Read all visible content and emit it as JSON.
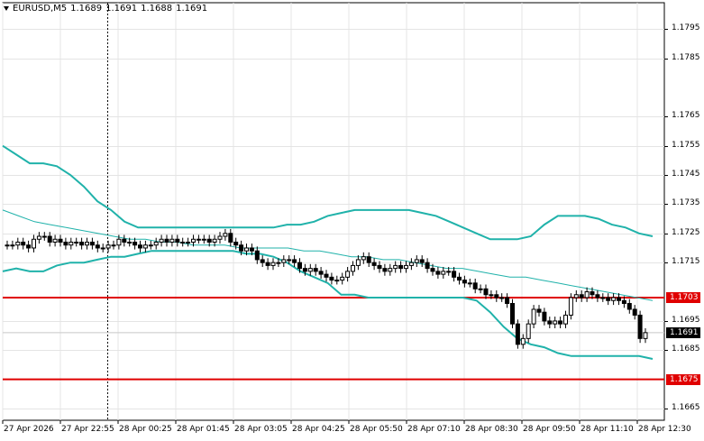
{
  "window": {
    "symbol": "EURUSD,M5",
    "quotes": [
      "1.1689",
      "1.1691",
      "1.1688",
      "1.1691"
    ],
    "menu_icon": "triangle-down-icon"
  },
  "price_axis": {
    "ticks": [
      "1.1795",
      "1.1785",
      "1.1765",
      "1.1755",
      "1.1745",
      "1.1735",
      "1.1725",
      "1.1715",
      "1.1695",
      "1.1685",
      "1.1665"
    ],
    "tick_values": [
      1.1795,
      1.1785,
      1.1765,
      1.1755,
      1.1745,
      1.1735,
      1.1725,
      1.1715,
      1.1695,
      1.1685,
      1.1665
    ]
  },
  "time_axis": {
    "labels": [
      "27 Apr 2026",
      "27 Apr 22:55",
      "28 Apr 00:25",
      "28 Apr 01:45",
      "28 Apr 03:05",
      "28 Apr 04:25",
      "28 Apr 05:50",
      "28 Apr 07:10",
      "28 Apr 08:30",
      "28 Apr 09:50",
      "28 Apr 11:10",
      "28 Apr 12:30"
    ]
  },
  "horizontal_lines": [
    {
      "price": 1.1703,
      "label": "1.1703",
      "color": "#e00000"
    },
    {
      "price": 1.1675,
      "label": "1.1675",
      "color": "#e00000"
    }
  ],
  "current_price": {
    "label": "1.1691",
    "value": 1.1691,
    "bg": "#000000",
    "fg": "#ffffff"
  },
  "colors": {
    "bollinger": "#20b2aa",
    "ma": "#20b2aa",
    "level": "#e00000",
    "candle": "#000000",
    "grid": "#e4e4e4"
  },
  "chart_data": {
    "type": "candlestick",
    "symbol": "EURUSD",
    "timeframe": "M5",
    "ylim": [
      1.1661,
      1.1804
    ],
    "grid": true,
    "x_ticks": [
      "27 Apr 2026",
      "27 Apr 22:55",
      "28 Apr 00:25",
      "28 Apr 01:45",
      "28 Apr 03:05",
      "28 Apr 04:25",
      "28 Apr 05:50",
      "28 Apr 07:10",
      "28 Apr 08:30",
      "28 Apr 09:50",
      "28 Apr 11:10",
      "28 Apr 12:30"
    ],
    "y_ticks": [
      1.1795,
      1.1785,
      1.1765,
      1.1755,
      1.1745,
      1.1735,
      1.1725,
      1.1715,
      1.1695,
      1.1685,
      1.1665
    ],
    "close": [
      1.1721,
      1.1721,
      1.1722,
      1.1721,
      1.172,
      1.1723,
      1.1724,
      1.1724,
      1.1722,
      1.1723,
      1.1722,
      1.1721,
      1.1722,
      1.1722,
      1.1721,
      1.1722,
      1.1721,
      1.172,
      1.172,
      1.1721,
      1.1721,
      1.1723,
      1.1722,
      1.1722,
      1.1721,
      1.172,
      1.1721,
      1.1721,
      1.1722,
      1.1723,
      1.1722,
      1.1723,
      1.1722,
      1.1722,
      1.1722,
      1.1723,
      1.1723,
      1.1723,
      1.1722,
      1.1723,
      1.1724,
      1.1725,
      1.1722,
      1.1721,
      1.1719,
      1.172,
      1.1719,
      1.1716,
      1.1715,
      1.1714,
      1.1715,
      1.1715,
      1.1716,
      1.1716,
      1.1715,
      1.1713,
      1.1712,
      1.1713,
      1.1712,
      1.1711,
      1.171,
      1.1709,
      1.1709,
      1.171,
      1.1712,
      1.1714,
      1.1716,
      1.1717,
      1.1715,
      1.1714,
      1.1713,
      1.1712,
      1.1713,
      1.1714,
      1.1713,
      1.1714,
      1.1715,
      1.1716,
      1.1715,
      1.1713,
      1.1712,
      1.1711,
      1.1712,
      1.1712,
      1.171,
      1.1709,
      1.1708,
      1.1708,
      1.1706,
      1.1706,
      1.1704,
      1.1704,
      1.1703,
      1.1703,
      1.1701,
      1.1694,
      1.1687,
      1.1689,
      1.1694,
      1.1699,
      1.1698,
      1.1695,
      1.1694,
      1.1695,
      1.1694,
      1.1697,
      1.1703,
      1.1704,
      1.1703,
      1.1705,
      1.1704,
      1.1703,
      1.1703,
      1.1702,
      1.1703,
      1.1702,
      1.1701,
      1.1699,
      1.1697,
      1.1689,
      1.1691
    ],
    "series": [
      {
        "name": "Bollinger upper",
        "values": [
          1.1755,
          1.1752,
          1.1749,
          1.1749,
          1.1748,
          1.1745,
          1.1741,
          1.1736,
          1.1733,
          1.1729,
          1.1727,
          1.1727,
          1.1727,
          1.1727,
          1.1727,
          1.1727,
          1.1727,
          1.1727,
          1.1727,
          1.1727,
          1.1727,
          1.1728,
          1.1728,
          1.1729,
          1.1731,
          1.1732,
          1.1733,
          1.1733,
          1.1733,
          1.1733,
          1.1733,
          1.1732,
          1.1731,
          1.1729,
          1.1727,
          1.1725,
          1.1723,
          1.1723,
          1.1723,
          1.1724,
          1.1728,
          1.1731,
          1.1731,
          1.1731,
          1.173,
          1.1728,
          1.1727,
          1.1725,
          1.1724
        ]
      },
      {
        "name": "Bollinger lower",
        "values": [
          1.1712,
          1.1713,
          1.1712,
          1.1712,
          1.1714,
          1.1715,
          1.1715,
          1.1716,
          1.1717,
          1.1717,
          1.1718,
          1.1719,
          1.1719,
          1.1719,
          1.1719,
          1.1719,
          1.1719,
          1.1719,
          1.1718,
          1.1718,
          1.1717,
          1.1715,
          1.1712,
          1.171,
          1.1708,
          1.1704,
          1.1704,
          1.1703,
          1.1703,
          1.1703,
          1.1703,
          1.1703,
          1.1703,
          1.1703,
          1.1703,
          1.1702,
          1.1698,
          1.1693,
          1.1689,
          1.1687,
          1.1686,
          1.1684,
          1.1683,
          1.1683,
          1.1683,
          1.1683,
          1.1683,
          1.1683,
          1.1682
        ]
      },
      {
        "name": "Moving average",
        "values": [
          1.1733,
          1.1731,
          1.1729,
          1.1728,
          1.1727,
          1.1726,
          1.1725,
          1.1724,
          1.1723,
          1.1723,
          1.1722,
          1.1722,
          1.1721,
          1.1721,
          1.1721,
          1.172,
          1.172,
          1.172,
          1.172,
          1.1719,
          1.1719,
          1.1718,
          1.1717,
          1.1717,
          1.1716,
          1.1716,
          1.1715,
          1.1714,
          1.1713,
          1.1713,
          1.1712,
          1.1711,
          1.171,
          1.171,
          1.1709,
          1.1708,
          1.1707,
          1.1706,
          1.1705,
          1.1704,
          1.1703,
          1.1702
        ]
      }
    ],
    "levels": [
      1.1703,
      1.1675
    ],
    "last_price": 1.1691
  }
}
